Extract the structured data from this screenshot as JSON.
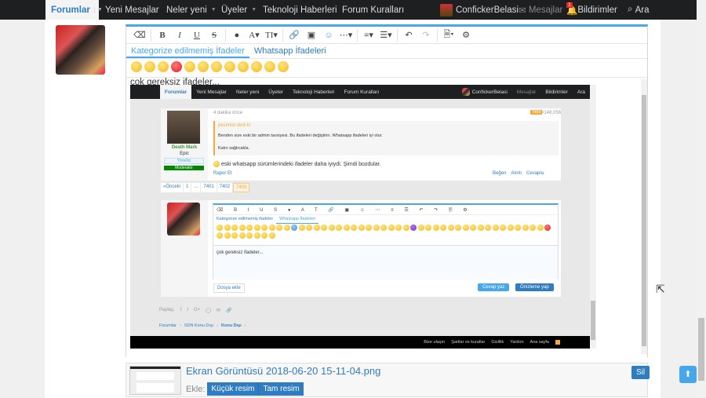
{
  "nav": {
    "items": [
      "Forumlar",
      "Yeni Mesajlar",
      "Neler yeni",
      "Üyeler",
      "Teknoloji Haberleri",
      "Forum Kuralları"
    ],
    "user": "ConfickerBelasi",
    "messages": "Mesajlar",
    "notifications": "Bildirimler",
    "notif_count": "1",
    "search": "Ara"
  },
  "editor": {
    "tabs": [
      "Kategorize edilmemiş İfadeler",
      "Whatsapp İfadeleri"
    ],
    "typed": "çok gereksiz ifadeler..."
  },
  "shot": {
    "nav": {
      "items": [
        "Forumlar",
        "Yeni Mesajlar",
        "Neler yeni",
        "Üyeler",
        "Teknoloji Haberleri",
        "Forum Kuralları"
      ],
      "user": "ConfickerBelasi",
      "messages": "Mesajlar",
      "notifications": "Bildirimler",
      "search": "Ara"
    },
    "post": {
      "time": "4 dakika önce",
      "badge": "Yeni",
      "number": "#148,056",
      "author": "Death Mark",
      "title": "Epic",
      "role1": "Yönetici",
      "role2": "Moderatör",
      "quote_author": "pesimist dedi ki:",
      "quote_text1": "Benden size eski bir admin tavsiyesi. Bu ifadeleri değiştirin. Whatsapp ifadeleri iyi olur.",
      "quote_text2": "Kalın sağlıcakla.",
      "message": "eski whatsapp sürümlerindeki ifadeler daha iyiydi. Şimdi bozdular.",
      "report": "Rapor Et",
      "like": "Beğen",
      "quote": "Alıntı",
      "reply": "Cevapla"
    },
    "pagination": [
      "«Önceki",
      "1",
      "...",
      "7401",
      "7402",
      "7403"
    ],
    "editor": {
      "tabs": [
        "Kategorize edilmemiş ifadeler",
        "Whatsapp İfadeleri"
      ],
      "typed": "çok gereksiz ifadeler...",
      "attach": "Dosya ekle",
      "submit": "Cevap yaz",
      "preview": "Önizleme yap"
    },
    "share": "Paylaş:",
    "breadcrumb": [
      "Forumlar",
      "SDN Konu Dışı",
      "Konu Dışı"
    ],
    "footer": [
      "Bize ulaşın",
      "Şartlar ve kurallar",
      "Gizlilik",
      "Yardım",
      "Ana sayfa"
    ]
  },
  "attachment": {
    "filename": "Ekran Görüntüsü 2018-06-20 15-11-04.png",
    "insert_label": "Ekle:",
    "thumb_btn": "Küçük resim",
    "full_btn": "Tam resim",
    "delete": "Sil"
  },
  "colors": {
    "accent": "#47a7eb",
    "link": "#2f7cc1",
    "nav_bg": "#1d1f21"
  }
}
